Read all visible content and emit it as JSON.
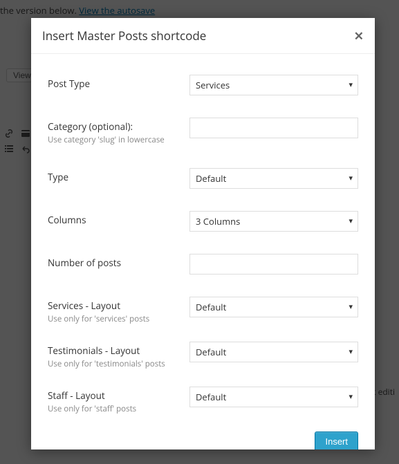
{
  "background": {
    "autosave_prefix": "the version below. ",
    "autosave_link": "View the autosave",
    "view_button": "View P",
    "footer_fragment": "st editi"
  },
  "modal": {
    "title": "Insert Master Posts shortcode",
    "fields": {
      "post_type": {
        "label": "Post Type",
        "value": "Services"
      },
      "category": {
        "label": "Category (optional):",
        "hint": "Use category 'slug' in lowercase",
        "value": ""
      },
      "type": {
        "label": "Type",
        "value": "Default"
      },
      "columns": {
        "label": "Columns",
        "value": "3 Columns"
      },
      "num_posts": {
        "label": "Number of posts",
        "value": ""
      },
      "services_layout": {
        "label": "Services - Layout",
        "hint": "Use only for 'services' posts",
        "value": "Default"
      },
      "testimonials_layout": {
        "label": "Testimonials - Layout",
        "hint": "Use only for 'testimonials' posts",
        "value": "Default"
      },
      "staff_layout": {
        "label": "Staff - Layout",
        "hint": "Use only for 'staff' posts",
        "value": "Default"
      }
    },
    "insert_button": "Insert"
  }
}
